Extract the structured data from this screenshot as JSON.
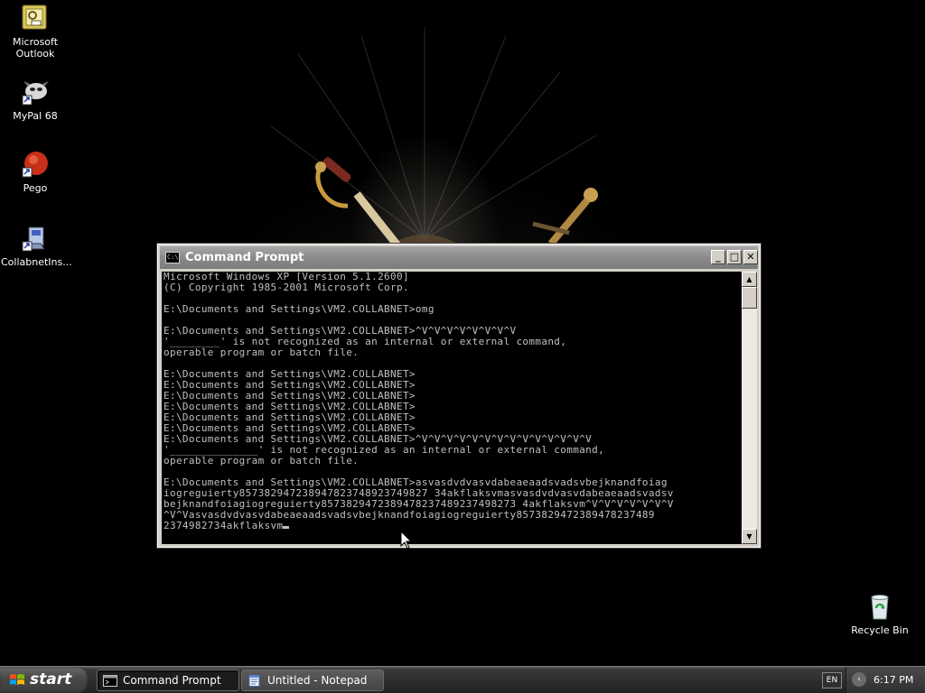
{
  "desktop": {
    "icons": [
      {
        "name": "microsoft-outlook",
        "label": "Microsoft\nOutlook"
      },
      {
        "name": "mypal",
        "label": "MyPal 68"
      },
      {
        "name": "pego",
        "label": "Pego"
      },
      {
        "name": "collabnet",
        "label": "CollabnetIns..."
      },
      {
        "name": "recycle-bin",
        "label": "Recycle Bin"
      }
    ]
  },
  "window": {
    "title": "Command Prompt",
    "icon_text": "C:\\",
    "minimize": "_",
    "maximize": "□",
    "close": "✕",
    "console_text": "Microsoft Windows XP [Version 5.1.2600]\n(C) Copyright 1985-2001 Microsoft Corp.\n\nE:\\Documents and Settings\\VM2.COLLABNET>omg\n\nE:\\Documents and Settings\\VM2.COLLABNET>^V^V^V^V^V^V^V^V\n'________' is not recognized as an internal or external command,\noperable program or batch file.\n\nE:\\Documents and Settings\\VM2.COLLABNET>\nE:\\Documents and Settings\\VM2.COLLABNET>\nE:\\Documents and Settings\\VM2.COLLABNET>\nE:\\Documents and Settings\\VM2.COLLABNET>\nE:\\Documents and Settings\\VM2.COLLABNET>\nE:\\Documents and Settings\\VM2.COLLABNET>\nE:\\Documents and Settings\\VM2.COLLABNET>^V^V^V^V^V^V^V^V^V^V^V^V^V^V\n'______________' is not recognized as an internal or external command,\noperable program or batch file.\n\nE:\\Documents and Settings\\VM2.COLLABNET>asvasdvdvasvdabeaeaadsvadsvbejknandfoiag\niogreguierty857382947238947823748923749827 34akflaksvmasvasdvdvasvdabeaeaadsvadsv\nbejknandfoiagiogreguierty8573829472389478237489237498273 4akflaksvm^V^V^V^V^V^V^V\n^V^Vasvasdvdvasvdabeaeaadsvadsvbejknandfoiagiogreguierty8573829472389478237489\n2374982734akflaksvm"
  },
  "taskbar": {
    "start_label": "start",
    "buttons": [
      {
        "label": "Command Prompt",
        "active": true
      },
      {
        "label": "Untitled - Notepad",
        "active": false
      }
    ],
    "language": "EN",
    "clock": "6:17 PM"
  }
}
